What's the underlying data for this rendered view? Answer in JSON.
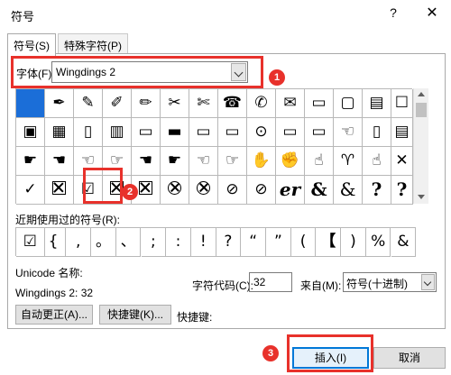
{
  "window": {
    "title": "符号",
    "help": "?",
    "close": "✕"
  },
  "tabs": [
    {
      "label": "符号(S)",
      "active": true
    },
    {
      "label": "特殊字符(P)",
      "active": false
    }
  ],
  "font": {
    "label": "字体(F):",
    "value": "Wingdings 2"
  },
  "grid_rows": [
    [
      "",
      "✒",
      "✎",
      "✐",
      "✏",
      "✂",
      "✄",
      "☎",
      "✆",
      "✉",
      "▭",
      "▢",
      "▤",
      "☐"
    ],
    [
      "▣",
      "▦",
      "▯",
      "▥",
      "▭",
      "▬",
      "▭",
      "▭",
      "⊙",
      "▭",
      "▭",
      "☜",
      "▯",
      "▤"
    ],
    [
      "☛",
      "☚",
      "☜",
      "☞",
      "☚",
      "☛",
      "☜",
      "☞",
      "✋",
      "✊",
      "☝",
      "♈",
      "☝",
      "✕"
    ],
    [
      "✓",
      "☒",
      "☑",
      "☒",
      "☒",
      "⊗",
      "⊗",
      "⊘",
      "⊘",
      "er",
      "&",
      "&",
      "?",
      "?",
      "?"
    ]
  ],
  "recent": {
    "label": "近期使用过的符号(R):",
    "symbols": [
      "☑",
      "{",
      ",",
      "。",
      "、",
      ";",
      ":",
      "!",
      "?",
      "“",
      "”",
      "(",
      "【",
      ")",
      "%",
      "&"
    ]
  },
  "unicode_name_label": "Unicode 名称:",
  "font_code": "Wingdings 2: 32",
  "char_code": {
    "label": "字符代码(C):",
    "value": "32"
  },
  "from": {
    "label": "来自(M):",
    "value": "符号(十进制)"
  },
  "buttons": {
    "autocorrect": "自动更正(A)...",
    "shortcut_key": "快捷键(K)...",
    "shortcut_label": "快捷键:",
    "insert": "插入(I)",
    "cancel": "取消"
  },
  "annotations": [
    "1",
    "2",
    "3"
  ],
  "colors": {
    "accent": "#e8312b",
    "selection": "#1b6ed8",
    "focus": "#0078d7"
  }
}
